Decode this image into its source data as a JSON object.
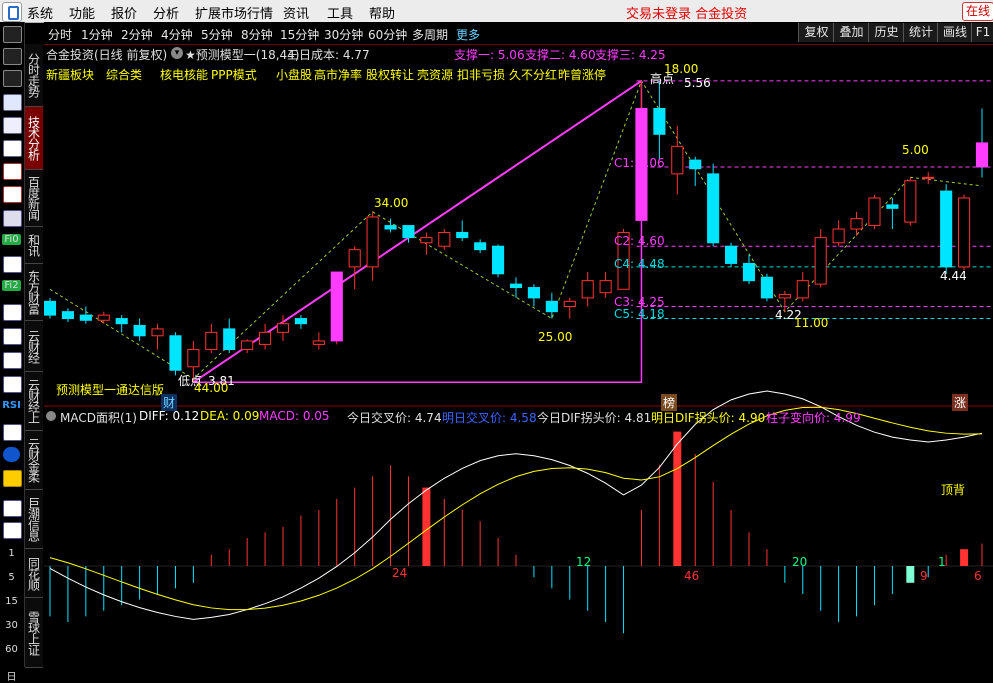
{
  "menu": {
    "items": [
      "系统",
      "功能",
      "报价",
      "分析",
      "扩展市场行情",
      "资讯",
      "工具",
      "帮助"
    ],
    "status_text": "交易未登录",
    "stock_link": "合金投资",
    "online_label": "在线"
  },
  "left_toolbar": {
    "labels": [
      "Fi0",
      "Fi2",
      "RSI",
      "1",
      "5",
      "15",
      "30",
      "60",
      "日"
    ]
  },
  "side_tabs": [
    "分时走势",
    "技术分析",
    "百度新闻",
    "和讯",
    "东方财富",
    "云财经",
    "云财经上",
    "云财金柔",
    "巨潮信息",
    "同花顺",
    "雪球上证"
  ],
  "periods": [
    "分时",
    "1分钟",
    "2分钟",
    "4分钟",
    "5分钟",
    "8分钟",
    "15分钟",
    "30分钟",
    "60分钟",
    "多周期",
    "更多"
  ],
  "right_buttons": [
    "复权",
    "叠加",
    "历史",
    "统计",
    "画线",
    "F1"
  ],
  "main": {
    "title": "合金投资(日线 前复权)",
    "indicator": "★预测模型一(18,44)",
    "cost_label": "三日成本: 4.77",
    "support1": "支撑一: 5.06",
    "support2": "支撑二: 4.60",
    "support3": "支撑三: 4.25",
    "tags": [
      "新疆板块",
      "综合类",
      "核电核能",
      "PPP模式",
      "小盘股",
      "高市净率",
      "股权转让",
      "壳资源",
      "扣非亏损",
      "久不分红",
      "昨曾涨停"
    ],
    "labels": {
      "high_point": "高点",
      "high_value": "5.56",
      "top_num": "18.00",
      "peak1": "34.00",
      "trough1": "25.00",
      "low_point": "低点",
      "low_value": "3.81",
      "low_bottom": "44.00",
      "c1": "C1: 5.06",
      "c2": "C2: 4.60",
      "c4": "C4: 4.48",
      "c3": "C3: 4.25",
      "c5": "C5: 4.18",
      "v422": "4.22",
      "v1100": "11.00",
      "v500": "5.00",
      "v444": "4.44",
      "model_name": "预测模型一通达信版",
      "cai": "财",
      "bang": "榜",
      "zhang": "涨"
    }
  },
  "macd": {
    "title": "MACD面积(1)",
    "diff": "DIFF: 0.12",
    "dea": "DEA: 0.09",
    "macd": "MACD: 0.05",
    "today_cross": "今日交叉价: 4.74",
    "tomorrow_cross": "明日交叉价: 4.58",
    "today_dif": "今日DIF拐头价: 4.81",
    "tomorrow_dif": "明日DIF拐头价: 4.90",
    "pillar_price": "柱子变向价: 4.99",
    "labels": {
      "n24": "24",
      "n12": "12",
      "n46": "46",
      "n20": "20",
      "n9": "9",
      "n1": "1",
      "n6": "6",
      "top_divergence": "顶背"
    }
  },
  "colors": {
    "up": "#ff3232",
    "down": "#00e5ff",
    "magenta": "#ff3cff",
    "yellow": "#ffff00",
    "label_cyan": "#00dcdc"
  },
  "chart_data": {
    "type": "candlestick",
    "price_axis_range": [
      3.8,
      5.6
    ],
    "candles": [
      {
        "o": 4.28,
        "h": 4.3,
        "l": 4.18,
        "c": 4.2
      },
      {
        "o": 4.22,
        "h": 4.24,
        "l": 4.16,
        "c": 4.18
      },
      {
        "o": 4.2,
        "h": 4.25,
        "l": 4.15,
        "c": 4.17
      },
      {
        "o": 4.17,
        "h": 4.22,
        "l": 4.15,
        "c": 4.2
      },
      {
        "o": 4.18,
        "h": 4.2,
        "l": 4.1,
        "c": 4.15
      },
      {
        "o": 4.14,
        "h": 4.18,
        "l": 4.05,
        "c": 4.08
      },
      {
        "o": 4.08,
        "h": 4.15,
        "l": 4.0,
        "c": 4.12
      },
      {
        "o": 4.08,
        "h": 4.1,
        "l": 3.85,
        "c": 3.88
      },
      {
        "o": 3.9,
        "h": 4.05,
        "l": 3.81,
        "c": 4.0
      },
      {
        "o": 4.0,
        "h": 4.15,
        "l": 3.98,
        "c": 4.1
      },
      {
        "o": 4.12,
        "h": 4.18,
        "l": 3.98,
        "c": 4.0
      },
      {
        "o": 4.0,
        "h": 4.06,
        "l": 3.98,
        "c": 4.05
      },
      {
        "o": 4.03,
        "h": 4.15,
        "l": 4.0,
        "c": 4.1
      },
      {
        "o": 4.1,
        "h": 4.2,
        "l": 4.05,
        "c": 4.15
      },
      {
        "o": 4.18,
        "h": 4.2,
        "l": 4.12,
        "c": 4.15
      },
      {
        "o": 4.03,
        "h": 4.1,
        "l": 4.0,
        "c": 4.05
      },
      {
        "o": 4.05,
        "h": 4.45,
        "l": 4.03,
        "c": 4.45
      },
      {
        "o": 4.48,
        "h": 4.6,
        "l": 4.35,
        "c": 4.58
      },
      {
        "o": 4.48,
        "h": 4.8,
        "l": 4.4,
        "c": 4.77
      },
      {
        "o": 4.72,
        "h": 4.76,
        "l": 4.68,
        "c": 4.7
      },
      {
        "o": 4.72,
        "h": 4.72,
        "l": 4.62,
        "c": 4.65
      },
      {
        "o": 4.62,
        "h": 4.68,
        "l": 4.55,
        "c": 4.65
      },
      {
        "o": 4.6,
        "h": 4.7,
        "l": 4.58,
        "c": 4.68
      },
      {
        "o": 4.68,
        "h": 4.75,
        "l": 4.63,
        "c": 4.65
      },
      {
        "o": 4.62,
        "h": 4.64,
        "l": 4.56,
        "c": 4.58
      },
      {
        "o": 4.6,
        "h": 4.61,
        "l": 4.42,
        "c": 4.44
      },
      {
        "o": 4.38,
        "h": 4.42,
        "l": 4.3,
        "c": 4.36
      },
      {
        "o": 4.36,
        "h": 4.38,
        "l": 4.25,
        "c": 4.3
      },
      {
        "o": 4.28,
        "h": 4.33,
        "l": 4.18,
        "c": 4.22
      },
      {
        "o": 4.25,
        "h": 4.3,
        "l": 4.18,
        "c": 4.28
      },
      {
        "o": 4.3,
        "h": 4.45,
        "l": 4.25,
        "c": 4.4
      },
      {
        "o": 4.33,
        "h": 4.45,
        "l": 4.3,
        "c": 4.4
      },
      {
        "o": 4.35,
        "h": 4.7,
        "l": 4.35,
        "c": 4.68
      },
      {
        "o": 4.75,
        "h": 5.56,
        "l": 4.75,
        "c": 5.4
      },
      {
        "o": 5.4,
        "h": 5.56,
        "l": 5.1,
        "c": 5.25
      },
      {
        "o": 5.02,
        "h": 5.3,
        "l": 4.9,
        "c": 5.18
      },
      {
        "o": 5.1,
        "h": 5.12,
        "l": 4.95,
        "c": 5.05
      },
      {
        "o": 5.02,
        "h": 5.08,
        "l": 4.6,
        "c": 4.62
      },
      {
        "o": 4.6,
        "h": 4.62,
        "l": 4.48,
        "c": 4.5
      },
      {
        "o": 4.5,
        "h": 4.55,
        "l": 4.38,
        "c": 4.4
      },
      {
        "o": 4.42,
        "h": 4.44,
        "l": 4.28,
        "c": 4.3
      },
      {
        "o": 4.3,
        "h": 4.34,
        "l": 4.22,
        "c": 4.32
      },
      {
        "o": 4.3,
        "h": 4.45,
        "l": 4.28,
        "c": 4.4
      },
      {
        "o": 4.38,
        "h": 4.7,
        "l": 4.36,
        "c": 4.65
      },
      {
        "o": 4.62,
        "h": 4.75,
        "l": 4.6,
        "c": 4.7
      },
      {
        "o": 4.7,
        "h": 4.8,
        "l": 4.66,
        "c": 4.76
      },
      {
        "o": 4.72,
        "h": 4.9,
        "l": 4.7,
        "c": 4.88
      },
      {
        "o": 4.84,
        "h": 4.88,
        "l": 4.7,
        "c": 4.82
      },
      {
        "o": 4.74,
        "h": 5.0,
        "l": 4.72,
        "c": 4.98
      },
      {
        "o": 5.0,
        "h": 5.03,
        "l": 4.96,
        "c": 5.0
      },
      {
        "o": 4.92,
        "h": 4.96,
        "l": 4.44,
        "c": 4.48
      },
      {
        "o": 4.48,
        "h": 4.9,
        "l": 4.46,
        "c": 4.88
      },
      {
        "o": 5.2,
        "h": 5.4,
        "l": 5.0,
        "c": 5.06
      }
    ],
    "macd_histogram": [
      -0.09,
      -0.1,
      -0.09,
      -0.08,
      -0.07,
      -0.06,
      -0.05,
      -0.04,
      -0.03,
      0.02,
      0.03,
      0.05,
      0.06,
      0.07,
      0.09,
      0.1,
      0.12,
      0.14,
      0.16,
      0.18,
      0.16,
      0.14,
      0.12,
      0.1,
      0.08,
      0.05,
      0.02,
      -0.02,
      -0.04,
      -0.06,
      -0.08,
      -0.1,
      -0.12,
      0.1,
      0.18,
      0.24,
      0.2,
      0.15,
      0.1,
      0.06,
      0.03,
      -0.03,
      -0.05,
      -0.08,
      -0.1,
      -0.09,
      -0.07,
      -0.05,
      -0.03,
      -0.02,
      0.02,
      0.03,
      0.04
    ]
  }
}
